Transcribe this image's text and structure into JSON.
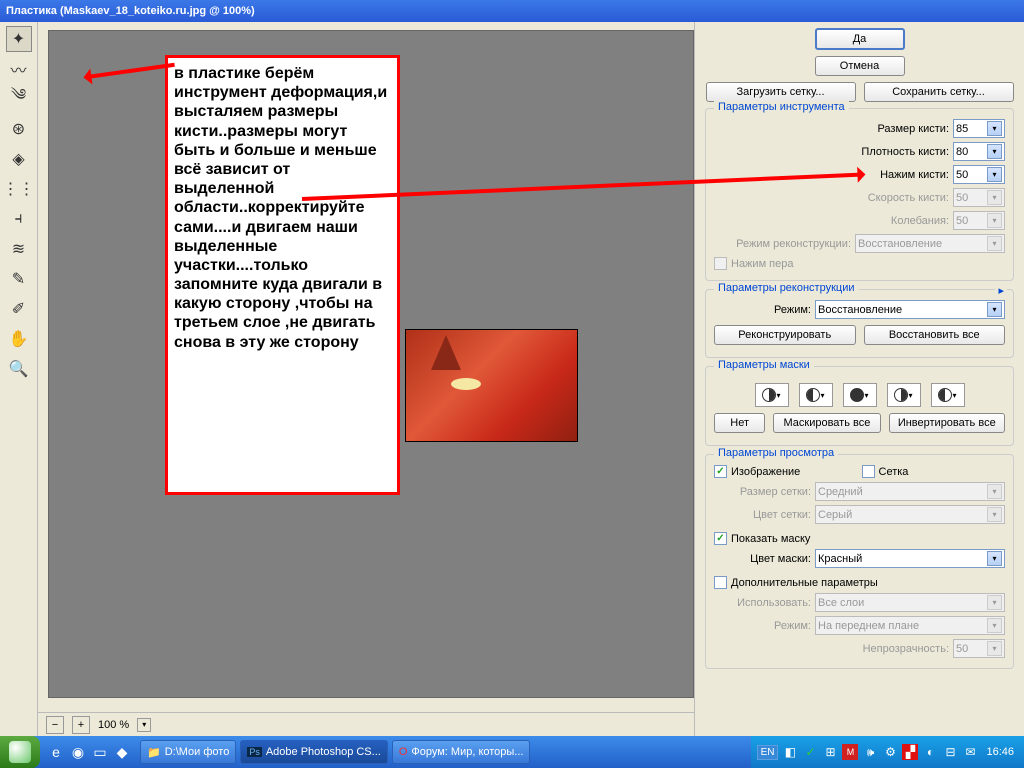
{
  "titlebar": "Пластика (Maskaev_18_koteiko.ru.jpg @ 100%)",
  "note": "в пластике берём инструмент деформация,и высталяем размеры кисти..размеры могут быть и больше и меньше всё зависит от выделенной области..корректируйте сами....и двигаем наши выделенные участки....только запомните куда двигали в какую сторону ,чтобы на третьем слое ,не двигать снова в эту же сторону",
  "zoom": "100 %",
  "buttons": {
    "ok": "Да",
    "cancel": "Отмена",
    "load_mesh": "Загрузить сетку...",
    "save_mesh": "Сохранить сетку...",
    "reconstruct": "Реконструировать",
    "restore_all": "Восстановить все",
    "none": "Нет",
    "mask_all": "Маскировать все",
    "invert_all": "Инвертировать все"
  },
  "groups": {
    "tool_options": "Параметры инструмента",
    "recon_options": "Параметры реконструкции",
    "mask_options": "Параметры маски",
    "view_options": "Параметры просмотра"
  },
  "labels": {
    "brush_size": "Размер кисти:",
    "brush_density": "Плотность кисти:",
    "brush_pressure": "Нажим кисти:",
    "brush_rate": "Скорость кисти:",
    "turbulence": "Колебания:",
    "recon_mode": "Режим реконструкции:",
    "pen_pressure": "Нажим пера",
    "mode": "Режим:",
    "show_image": "Изображение",
    "show_mesh": "Сетка",
    "mesh_size": "Размер сетки:",
    "mesh_color": "Цвет сетки:",
    "show_mask": "Показать маску",
    "mask_color": "Цвет маски:",
    "additional": "Дополнительные параметры",
    "use": "Использовать:",
    "mode2": "Режим:",
    "opacity": "Непрозрачность:"
  },
  "values": {
    "brush_size": "85",
    "brush_density": "80",
    "brush_pressure": "50",
    "brush_rate": "50",
    "turbulence": "50",
    "recon_mode": "Восстановление",
    "mode": "Восстановление",
    "mesh_size": "Средний",
    "mesh_color": "Серый",
    "mask_color": "Красный",
    "use": "Все слои",
    "mode2": "На переднем плане",
    "opacity": "50"
  },
  "taskbar": {
    "task1": "D:\\Мои фото",
    "task2": "Adobe Photoshop CS...",
    "task3": "Форум: Мир, которы...",
    "lang": "EN",
    "clock": "16:46"
  }
}
